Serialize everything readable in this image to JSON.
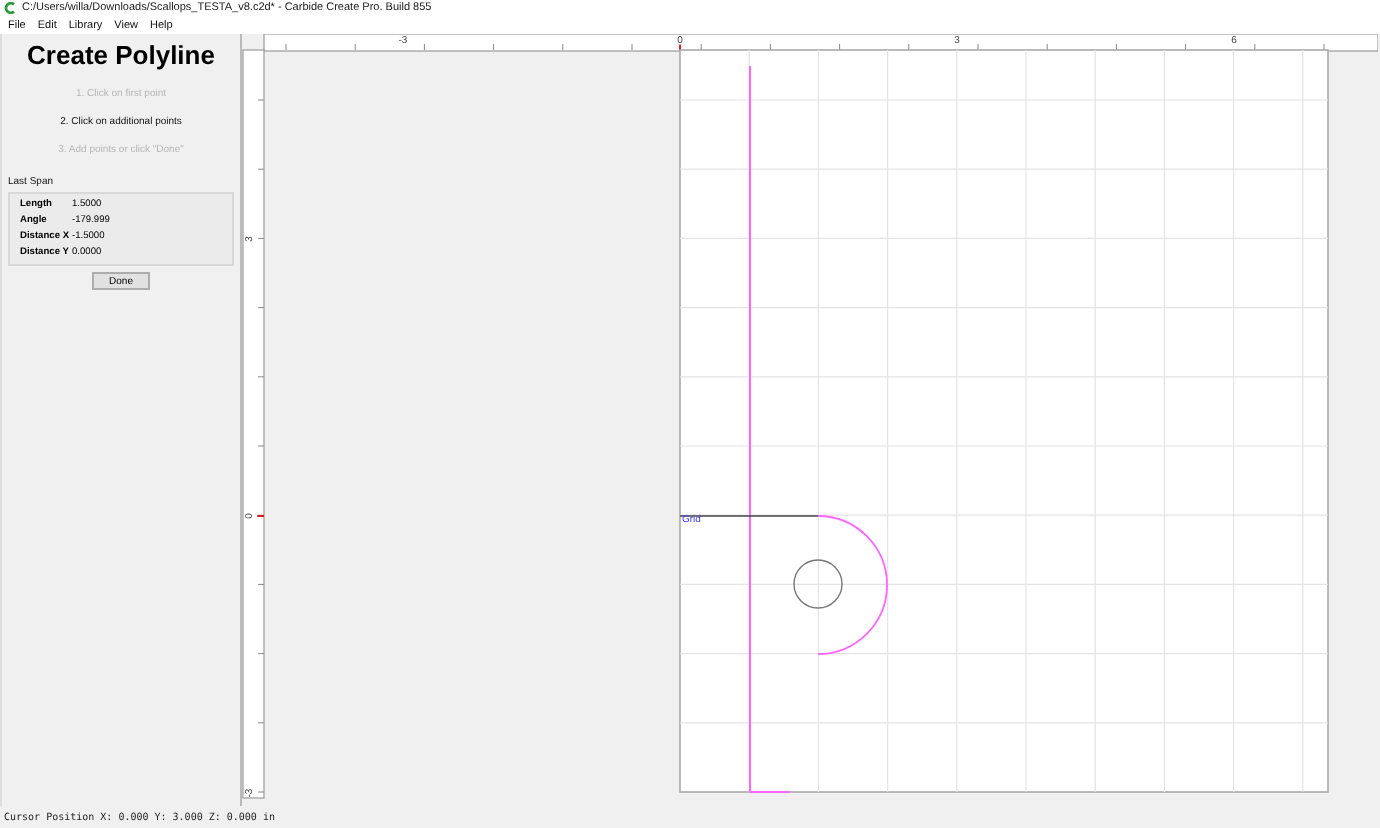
{
  "window": {
    "title": "C:/Users/willa/Downloads/Scallops_TESTA_v8.c2d* - Carbide Create Pro. Build 855"
  },
  "menu": [
    "File",
    "Edit",
    "Library",
    "View",
    "Help"
  ],
  "panel": {
    "heading": "Create Polyline",
    "steps": [
      {
        "text": "1. Click on first point",
        "current": false
      },
      {
        "text": "2. Click on additional points",
        "current": true
      },
      {
        "text": "3. Add points or click \"Done\"",
        "current": false
      }
    ],
    "section_title": "Last Span",
    "fields": [
      {
        "label": "Length",
        "value": "1.5000"
      },
      {
        "label": "Angle",
        "value": "-179.999"
      },
      {
        "label": "Distance X",
        "value": "-1.5000"
      },
      {
        "label": "Distance Y",
        "value": "0.0000"
      }
    ],
    "button": "Done"
  },
  "canvas": {
    "x_ruler": [
      "-3",
      "0",
      "3",
      "6"
    ],
    "y_ruler": [
      "3",
      "0",
      "-3"
    ],
    "grid_label": "Grid"
  },
  "status_bar": "Cursor Position X: 0.000 Y: 3.000 Z: 0.000 in"
}
